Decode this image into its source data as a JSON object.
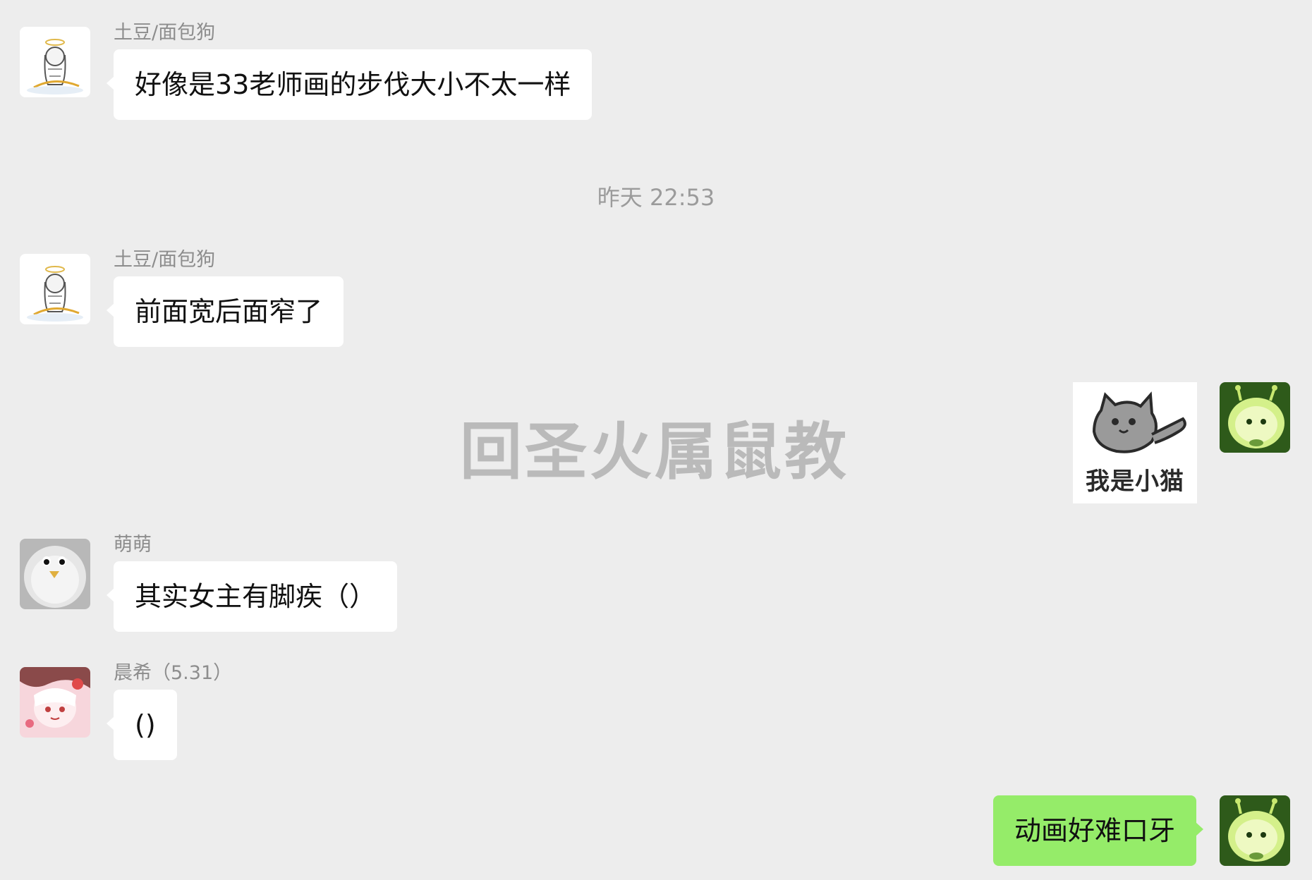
{
  "messages": [
    {
      "sender": "土豆/面包狗",
      "text": "好像是33老师画的步伐大小不太一样",
      "avatar": "angel-sketch-avatar-icon"
    },
    {
      "sender": "土豆/面包狗",
      "text": "前面宽后面窄了",
      "avatar": "angel-sketch-avatar-icon"
    },
    {
      "sender": "萌萌",
      "text": "其实女主有脚疾（）",
      "avatar": "fluffy-chick-avatar-icon"
    },
    {
      "sender": "晨希（5.31）",
      "text": "()",
      "avatar": "anime-girl-avatar-icon"
    }
  ],
  "timestamp": "昨天 22:53",
  "self": {
    "sticker_caption": "我是小猫",
    "reply": "动画好难口牙",
    "avatar": "green-creature-avatar-icon"
  },
  "watermark": "回圣火属鼠教",
  "colors": {
    "background": "#ededed",
    "incoming_bubble": "#ffffff",
    "outgoing_bubble": "#95ec69",
    "meta_text": "#8d8d8d"
  }
}
